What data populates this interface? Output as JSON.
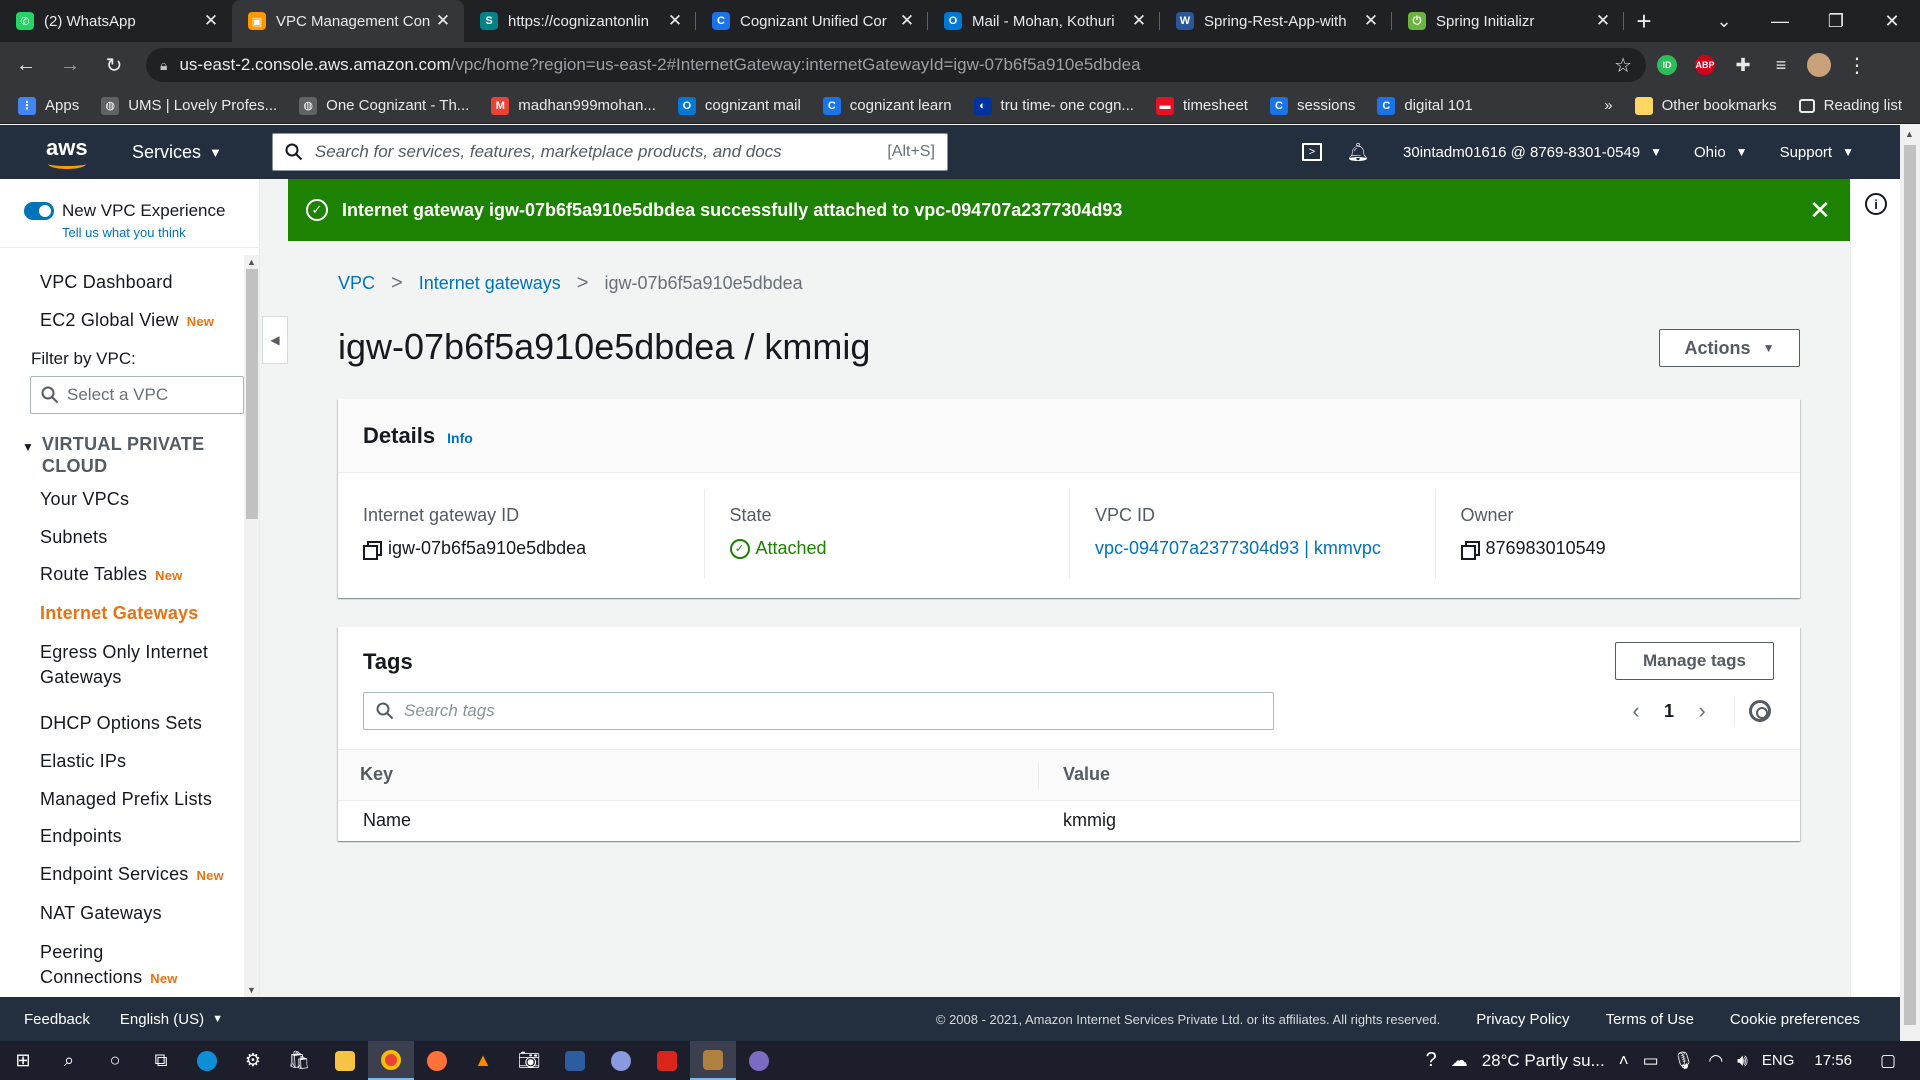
{
  "browser": {
    "tabs": [
      {
        "title": "(2) WhatsApp",
        "icon": "whatsapp-icon",
        "color": "#25d366",
        "glyph": "✆"
      },
      {
        "title": "VPC Management Con",
        "icon": "aws-icon",
        "color": "#ff9900",
        "glyph": "▣"
      },
      {
        "title": "https://cognizantonlin",
        "icon": "sharepoint-icon",
        "color": "#038387",
        "glyph": "S"
      },
      {
        "title": "Cognizant Unified Cor",
        "icon": "cognizant-icon",
        "color": "#1a73e8",
        "glyph": "C"
      },
      {
        "title": "Mail - Mohan, Kothuri",
        "icon": "outlook-icon",
        "color": "#0078d4",
        "glyph": "O"
      },
      {
        "title": "Spring-Rest-App-with",
        "icon": "word-icon",
        "color": "#2b579a",
        "glyph": "W"
      },
      {
        "title": "Spring Initializr",
        "icon": "spring-icon",
        "color": "#6db33f",
        "glyph": "⏻"
      }
    ],
    "url_host": "us-east-2.console.aws.amazon.com",
    "url_path": "/vpc/home?region=us-east-2#InternetGateway:internetGatewayId=igw-07b6f5a910e5dbdea",
    "bookmarks": [
      {
        "label": "Apps",
        "color": "#4285f4",
        "glyph": "⋮"
      },
      {
        "label": "UMS | Lovely Profes...",
        "color": "#5f6368",
        "glyph": "◍"
      },
      {
        "label": "One Cognizant - Th...",
        "color": "#5f6368",
        "glyph": "◍"
      },
      {
        "label": "madhan999mohan...",
        "color": "#ea4335",
        "glyph": "M"
      },
      {
        "label": "cognizant mail",
        "color": "#0078d4",
        "glyph": "O"
      },
      {
        "label": "cognizant learn",
        "color": "#1a73e8",
        "glyph": "C"
      },
      {
        "label": "tru time- one cogn...",
        "color": "#0033a0",
        "glyph": "◐"
      },
      {
        "label": "timesheet",
        "color": "#e81123",
        "glyph": "▬"
      },
      {
        "label": "sessions",
        "color": "#1a73e8",
        "glyph": "C"
      },
      {
        "label": "digital 101",
        "color": "#1a73e8",
        "glyph": "C"
      }
    ],
    "bookmark_more": "»",
    "other_bookmarks": "Other bookmarks",
    "reading_list": "Reading list"
  },
  "aws_nav": {
    "logo": "aws",
    "services": "Services",
    "search_placeholder": "Search for services, features, marketplace products, and docs",
    "search_shortcut": "[Alt+S]",
    "account": "30intadm01616 @ 8769-8301-0549",
    "region": "Ohio",
    "support": "Support"
  },
  "sidebar": {
    "toggle_label": "New VPC Experience",
    "feedback_link": "Tell us what you think",
    "filter_label": "Filter by VPC:",
    "filter_placeholder": "Select a VPC",
    "section": "VIRTUAL PRIVATE CLOUD",
    "new_badge": "New",
    "top_items": [
      {
        "label": "VPC Dashboard",
        "new": false
      },
      {
        "label": "EC2 Global View",
        "new": true
      }
    ],
    "items": [
      {
        "label": "Your VPCs",
        "new": false
      },
      {
        "label": "Subnets",
        "new": false
      },
      {
        "label": "Route Tables",
        "new": true
      },
      {
        "label": "Internet Gateways",
        "new": false,
        "active": true
      },
      {
        "label": "Egress Only Internet",
        "label2": "Gateways",
        "new": false
      },
      {
        "label": "DHCP Options Sets",
        "new": false
      },
      {
        "label": "Elastic IPs",
        "new": false
      },
      {
        "label": "Managed Prefix Lists",
        "new": false
      },
      {
        "label": "Endpoints",
        "new": false
      },
      {
        "label": "Endpoint Services",
        "new": true
      },
      {
        "label": "NAT Gateways",
        "new": false
      },
      {
        "label": "Peering",
        "label2": "Connections",
        "new": true
      }
    ]
  },
  "flash": {
    "message": "Internet gateway igw-07b6f5a910e5dbdea successfully attached to vpc-094707a2377304d93",
    "color": "#1d8102"
  },
  "breadcrumb": {
    "root": "VPC",
    "parent": "Internet gateways",
    "current": "igw-07b6f5a910e5dbdea"
  },
  "page": {
    "title": "igw-07b6f5a910e5dbdea / kmmig",
    "actions": "Actions"
  },
  "details": {
    "heading": "Details",
    "info": "Info",
    "gateway_id_label": "Internet gateway ID",
    "gateway_id": "igw-07b6f5a910e5dbdea",
    "state_label": "State",
    "state": "Attached",
    "vpc_label": "VPC ID",
    "vpc": "vpc-094707a2377304d93 | kmmvpc",
    "owner_label": "Owner",
    "owner": "876983010549"
  },
  "tags": {
    "heading": "Tags",
    "manage": "Manage tags",
    "search_placeholder": "Search tags",
    "page": "1",
    "columns": [
      "Key",
      "Value"
    ],
    "rows": [
      {
        "key": "Name",
        "value": "kmmig"
      }
    ]
  },
  "footer": {
    "feedback": "Feedback",
    "language": "English (US)",
    "copyright": "© 2008 - 2021, Amazon Internet Services Private Ltd. or its affiliates. All rights reserved.",
    "privacy": "Privacy Policy",
    "terms": "Terms of Use",
    "cookies": "Cookie preferences"
  },
  "taskbar": {
    "weather": "28°C  Partly su...",
    "language": "ENG",
    "time": "17:56"
  }
}
